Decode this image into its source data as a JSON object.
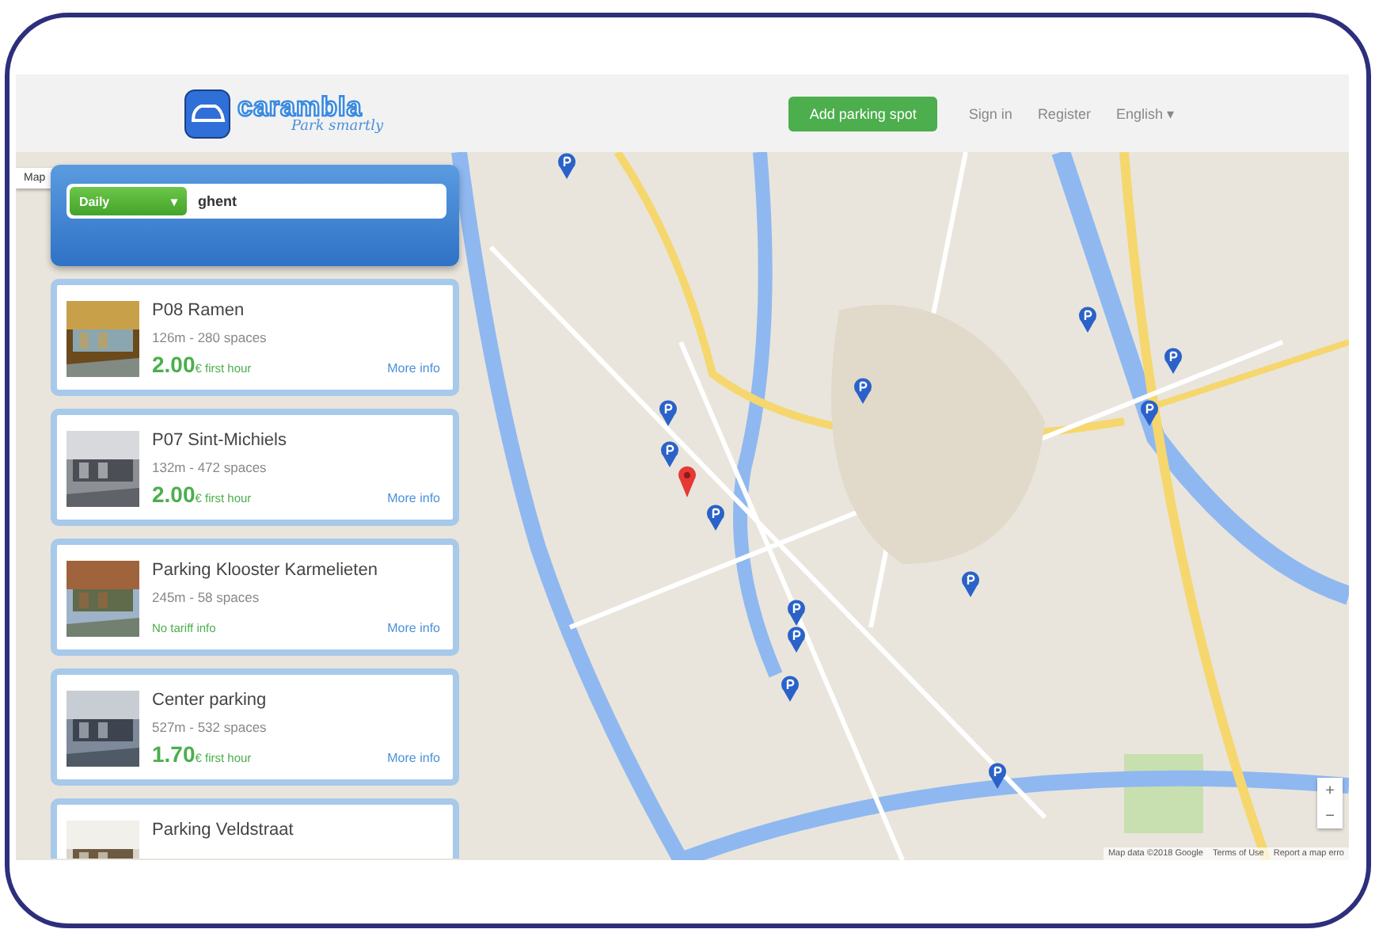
{
  "header": {
    "logo_text": "carambla",
    "tagline": "Park smartly",
    "add_button": "Add parking spot",
    "nav": [
      "Sign in",
      "Register"
    ],
    "language": "English",
    "language_caret": "▾"
  },
  "search": {
    "mode": "Daily",
    "mode_caret": "▾",
    "query": "ghent"
  },
  "results": [
    {
      "name": "P08 Ramen",
      "details": "126m - 280 spaces",
      "price": "2.00",
      "price_suffix": "€ first hour",
      "link": "More info"
    },
    {
      "name": "P07 Sint-Michiels",
      "details": "132m - 472 spaces",
      "price": "2.00",
      "price_suffix": "€ first hour",
      "link": "More info"
    },
    {
      "name": "Parking Klooster Karmelieten",
      "details": "245m - 58 spaces",
      "tariff_note": "No tariff info",
      "link": "More info"
    },
    {
      "name": "Center parking",
      "details": "527m - 532 spaces",
      "price": "1.70",
      "price_suffix": "€ first hour",
      "link": "More info"
    },
    {
      "name": "Parking Veldstraat"
    }
  ],
  "map": {
    "type_button": "Map",
    "zoom_in": "+",
    "zoom_out": "−",
    "attribution": [
      "Map data ©2018 Google",
      "Terms of Use",
      "Report a map erro"
    ]
  }
}
